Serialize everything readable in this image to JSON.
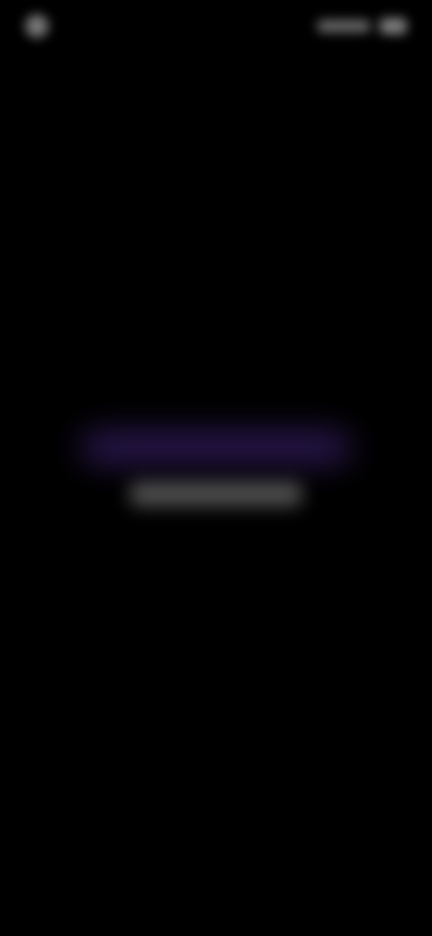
{
  "status_bar": {
    "time": "",
    "left_icon": "app-indicator-icon",
    "right_icons": [
      "signal-icon",
      "battery-icon"
    ]
  },
  "splash": {
    "title": "",
    "subtitle": ""
  },
  "colors": {
    "background": "#000000",
    "brand_purple": "#7e4fd6",
    "subtitle_text": "#e8e8e8"
  }
}
